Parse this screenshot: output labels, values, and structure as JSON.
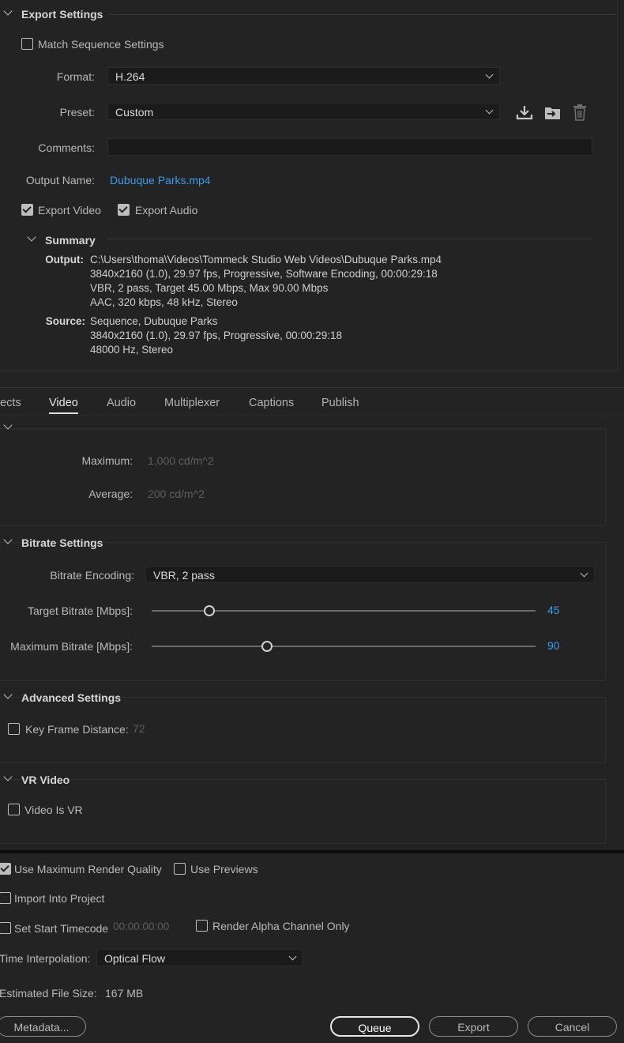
{
  "export_settings": {
    "title": "Export Settings",
    "match_sequence": {
      "label": "Match Sequence Settings",
      "checked": false
    },
    "format": {
      "label": "Format:",
      "value": "H.264"
    },
    "preset": {
      "label": "Preset:",
      "value": "Custom"
    },
    "comments": {
      "label": "Comments:",
      "value": ""
    },
    "output_name": {
      "label": "Output Name:",
      "value": "Dubuque Parks.mp4"
    },
    "export_video": {
      "label": "Export Video",
      "checked": true
    },
    "export_audio": {
      "label": "Export Audio",
      "checked": true
    },
    "icons": [
      "save-preset-icon",
      "import-preset-icon",
      "delete-preset-icon"
    ]
  },
  "summary": {
    "title": "Summary",
    "output_key": "Output:",
    "output_lines": [
      "C:\\Users\\thoma\\Videos\\Tommeck Studio Web Videos\\Dubuque Parks.mp4",
      "3840x2160 (1.0), 29.97 fps, Progressive, Software Encoding, 00:00:29:18",
      "VBR, 2 pass, Target 45.00 Mbps, Max 90.00 Mbps",
      "AAC, 320 kbps, 48 kHz, Stereo"
    ],
    "source_key": "Source:",
    "source_lines": [
      "Sequence, Dubuque Parks",
      "3840x2160 (1.0), 29.97 fps, Progressive, 00:00:29:18",
      "48000 Hz, Stereo"
    ]
  },
  "tabs": [
    {
      "label": "ects",
      "active": false
    },
    {
      "label": "Video",
      "active": true
    },
    {
      "label": "Audio",
      "active": false
    },
    {
      "label": "Multiplexer",
      "active": false
    },
    {
      "label": "Captions",
      "active": false
    },
    {
      "label": "Publish",
      "active": false
    }
  ],
  "hdr": {
    "maximum_label": "Maximum:",
    "maximum_value": "1,000 cd/m^2",
    "average_label": "Average:",
    "average_value": "200 cd/m^2"
  },
  "bitrate": {
    "title": "Bitrate Settings",
    "encoding_label": "Bitrate Encoding:",
    "encoding_value": "VBR, 2 pass",
    "target_label": "Target Bitrate [Mbps]:",
    "target_value": "45",
    "target_fraction": 0.15,
    "max_label": "Maximum Bitrate [Mbps]:",
    "max_value": "90",
    "max_fraction": 0.3
  },
  "advanced": {
    "title": "Advanced Settings",
    "keyframe_label": "Key Frame Distance:",
    "keyframe_value": "72",
    "keyframe_checked": false
  },
  "vr": {
    "title": "VR Video",
    "vr_label": "Video Is VR",
    "vr_checked": false
  },
  "bottom": {
    "max_quality": {
      "label": "Use Maximum Render Quality",
      "checked": true
    },
    "use_previews": {
      "label": "Use Previews",
      "checked": false
    },
    "import_project": {
      "label": "Import Into Project",
      "checked": false
    },
    "start_timecode": {
      "label": "Set Start Timecode",
      "checked": false,
      "value": "00:00:00:00"
    },
    "alpha_only": {
      "label": "Render Alpha Channel Only",
      "checked": false
    },
    "interp_label": "Time Interpolation:",
    "interp_value": "Optical Flow",
    "filesize_label": "Estimated File Size:",
    "filesize_value": "167 MB"
  },
  "buttons": {
    "metadata": "Metadata...",
    "queue": "Queue",
    "export": "Export",
    "cancel": "Cancel"
  }
}
